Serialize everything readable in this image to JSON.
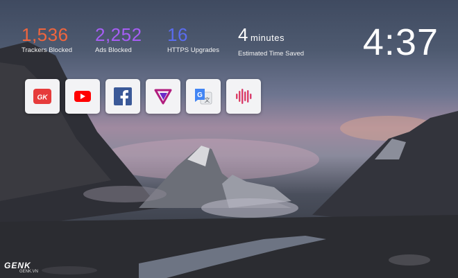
{
  "stats": [
    {
      "value": "1,536",
      "label": "Trackers Blocked",
      "color": "#f0653e"
    },
    {
      "value": "2,252",
      "label": "Ads Blocked",
      "color": "#a65ef5"
    },
    {
      "value": "16",
      "label": "HTTPS Upgrades",
      "color": "#5a6cf0"
    },
    {
      "value": "4",
      "unit": "minutes",
      "label": "Estimated Time Saved",
      "color": "#ffffff"
    }
  ],
  "clock": "4:37",
  "top_sites": [
    {
      "name": "GK",
      "icon": "genk-logo-icon"
    },
    {
      "name": "YouTube",
      "icon": "youtube-icon"
    },
    {
      "name": "Facebook",
      "icon": "facebook-icon"
    },
    {
      "name": "Vidmate",
      "icon": "vidmate-icon"
    },
    {
      "name": "Google Translate",
      "icon": "google-translate-icon"
    },
    {
      "name": "Sound",
      "icon": "soundwave-icon"
    }
  ],
  "watermark": {
    "brand": "GENK",
    "site": "GENK.VN"
  }
}
